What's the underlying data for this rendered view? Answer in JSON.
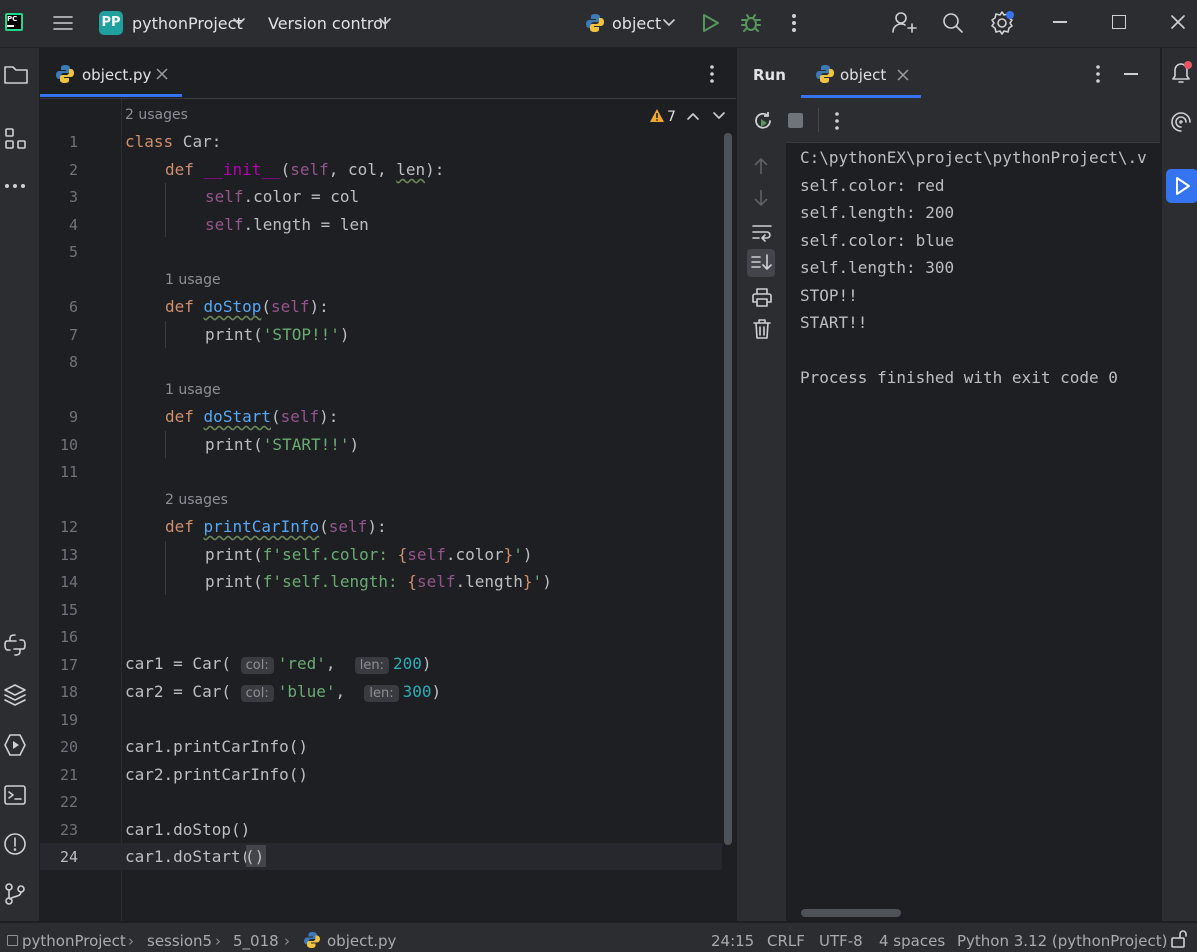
{
  "titlebar": {
    "project_badge": "PP",
    "project_name": "pythonProject",
    "vcs": "Version control",
    "run_config": "object"
  },
  "editor": {
    "tab_label": "object.py",
    "warnings_count": "7",
    "usages": [
      "2 usages",
      "1 usage",
      "1 usage",
      "2 usages"
    ],
    "line_numbers": [
      "1",
      "2",
      "3",
      "4",
      "5",
      "6",
      "7",
      "8",
      "9",
      "10",
      "11",
      "12",
      "13",
      "14",
      "15",
      "16",
      "17",
      "18",
      "19",
      "20",
      "21",
      "22",
      "23",
      "24"
    ],
    "code": {
      "l1_kw": "class",
      "l1_name": " Car:",
      "l2_kw": "def",
      "l2_fn": "__init__",
      "l2_self": "self",
      "l2_rest": ", col, ",
      "l2_len": "len",
      "l2_end": "):",
      "l3_self": "self",
      "l3_rest": ".color = col",
      "l4_self": "self",
      "l4_rest": ".length = len",
      "l6_kw": "def",
      "l6_fn": "doStop",
      "l6_self": "self",
      "l7_print": "print(",
      "l7_str": "'STOP!!'",
      "l7_end": ")",
      "l9_kw": "def",
      "l9_fn": "doStart",
      "l9_self": "self",
      "l10_print": "print(",
      "l10_str": "'START!!'",
      "l10_end": ")",
      "l12_kw": "def",
      "l12_fn": "printCarInfo",
      "l12_self": "self",
      "l13_print": "print(",
      "l13_str1": "f'self.color: ",
      "l13_br1": "{",
      "l13_self": "self",
      "l13_attr": ".color",
      "l13_br2": "}",
      "l13_str2": "'",
      "l13_end": ")",
      "l14_print": "print(",
      "l14_str1": "f'self.length: ",
      "l14_br1": "{",
      "l14_self": "self",
      "l14_attr": ".length",
      "l14_br2": "}",
      "l14_str2": "'",
      "l14_end": ")",
      "l17_pre": "car1 = Car(",
      "l17_hint1": "col:",
      "l17_str": "'red'",
      "l17_sep": ", ",
      "l17_hint2": "len:",
      "l17_num": "200",
      "l17_end": ")",
      "l18_pre": "car2 = Car(",
      "l18_hint1": "col:",
      "l18_str": "'blue'",
      "l18_sep": ", ",
      "l18_hint2": "len:",
      "l18_num": "300",
      "l18_end": ")",
      "l20": "car1.printCarInfo()",
      "l21": "car2.printCarInfo()",
      "l23": "car1.doStop()",
      "l24_pre": "car1.doStart(",
      "l24_par": "()",
      "l24_end": ""
    }
  },
  "run": {
    "title": "Run",
    "tab_label": "object",
    "output": [
      "C:\\pythonEX\\project\\pythonProject\\.v",
      "self.color: red",
      "self.length: 200",
      "self.color: blue",
      "self.length: 300",
      "STOP!!",
      "START!!",
      "",
      "Process finished with exit code 0"
    ]
  },
  "statusbar": {
    "breadcrumb": [
      "pythonProject",
      "session5",
      "5_018",
      "object.py"
    ],
    "position": "24:15",
    "line_sep": "CRLF",
    "encoding": "UTF-8",
    "indent": "4 spaces",
    "interpreter": "Python 3.12 (pythonProject)"
  },
  "colors": {
    "accent": "#3574f0",
    "run_green": "#57965c",
    "badge": "#21a0a0"
  }
}
